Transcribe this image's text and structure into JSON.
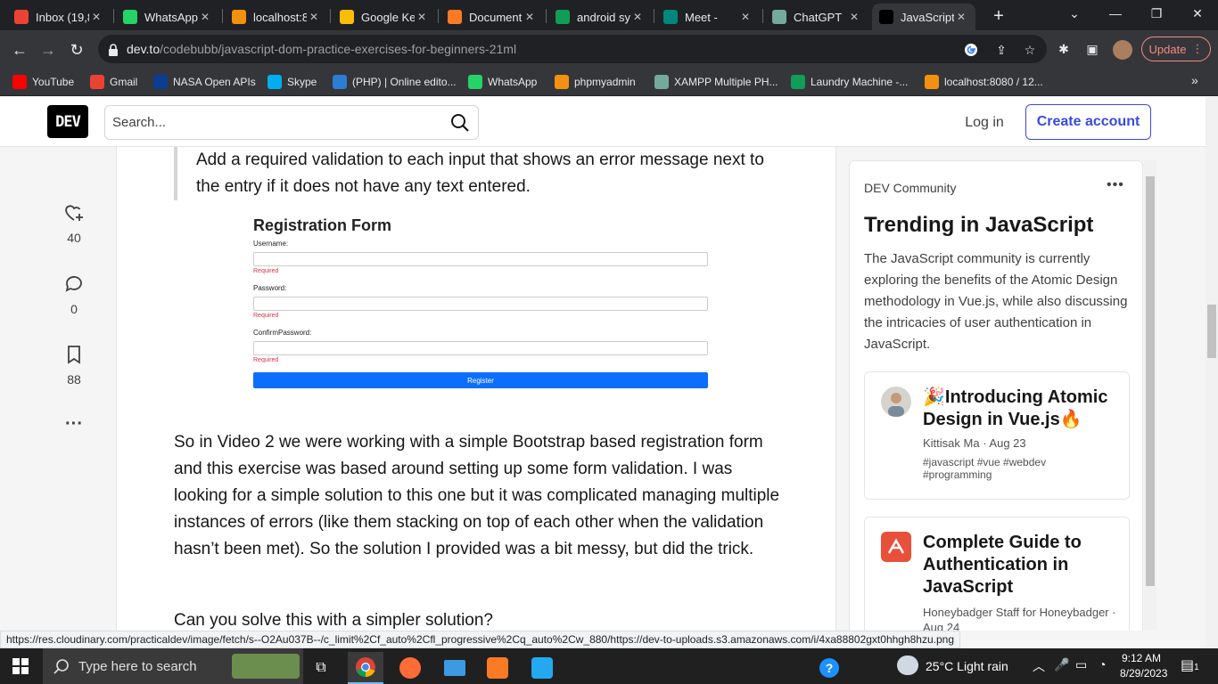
{
  "browser": {
    "tabs": [
      {
        "title": "Inbox (19,8",
        "icon": "gmail-icon",
        "color": "#ea4335"
      },
      {
        "title": "WhatsApp",
        "icon": "whatsapp-icon",
        "color": "#25d366"
      },
      {
        "title": "localhost:8",
        "icon": "phpmyadmin-icon",
        "color": "#f29111"
      },
      {
        "title": "Google Ke",
        "icon": "google-keep-icon",
        "color": "#fbbc04"
      },
      {
        "title": "Document",
        "icon": "xampp-icon",
        "color": "#fb7a24"
      },
      {
        "title": "android sy",
        "icon": "android-icon",
        "color": "#0f9d58"
      },
      {
        "title": "Meet -",
        "icon": "google-meet-icon",
        "color": "#00897b"
      },
      {
        "title": "ChatGPT",
        "icon": "chatgpt-icon",
        "color": "#74aa9c"
      },
      {
        "title": "JavaScript",
        "icon": "dev-icon",
        "color": "#000000",
        "active": true
      }
    ],
    "url_host": "dev.to",
    "url_path": "/codebubb/javascript-dom-practice-exercises-for-beginners-21ml",
    "update_label": "Update",
    "bookmarks": [
      {
        "label": "YouTube",
        "icon": "youtube-icon",
        "color": "#ff0000"
      },
      {
        "label": "Gmail",
        "icon": "gmail-icon",
        "color": "#ea4335"
      },
      {
        "label": "NASA Open APIs",
        "icon": "nasa-icon",
        "color": "#0b3d91"
      },
      {
        "label": "Skype",
        "icon": "skype-icon",
        "color": "#00aff0"
      },
      {
        "label": "(PHP) | Online edito...",
        "icon": "php-icon",
        "color": "#2d7dd2"
      },
      {
        "label": "WhatsApp",
        "icon": "whatsapp-icon",
        "color": "#25d366"
      },
      {
        "label": "phpmyadmin",
        "icon": "phpmyadmin-icon",
        "color": "#f29111"
      },
      {
        "label": "XAMPP Multiple PH...",
        "icon": "globe-icon",
        "color": "#74aa9c"
      },
      {
        "label": "Laundry Machine -...",
        "icon": "plus-icon",
        "color": "#0f9d58"
      },
      {
        "label": "localhost:8080 / 12...",
        "icon": "phpmyadmin-icon",
        "color": "#f29111"
      }
    ],
    "status_url": "https://res.cloudinary.com/practicaldev/image/fetch/s--O2Au037B--/c_limit%2Cf_auto%2Cfl_progressive%2Cq_auto%2Cw_880/https://dev-to-uploads.s3.amazonaws.com/i/4xa88802gxt0hhgh8hzu.png"
  },
  "header": {
    "logo": "DEV",
    "search_placeholder": "Search...",
    "login": "Log in",
    "create_account": "Create account"
  },
  "reactions": {
    "likes": "40",
    "comments": "0",
    "bookmarks": "88"
  },
  "article": {
    "blockquote": "Add a required validation to each input that shows an error message next to the entry if it does not have any text entered.",
    "figure": {
      "title": "Registration Form",
      "username_label": "Username:",
      "password_label": "Password:",
      "confirm_label": "ConfirmPassword:",
      "error": "Required",
      "button": "Register"
    },
    "paragraph1": "So in Video 2 we were working with a simple Bootstrap based registration form and this exercise was based around setting up some form validation. I was looking for a simple solution to this one but it was complicated managing multiple instances of errors (like them stacking on top of each other when the validation hasn’t been met). So the solution I provided was a bit messy, but did the trick.",
    "paragraph2": "Can you solve this with a simpler solution?"
  },
  "sidebar": {
    "source": "DEV Community",
    "title": "Trending in JavaScript",
    "description": "The JavaScript community is currently exploring the benefits of the Atomic Design methodology in Vue.js, while also discussing the intricacies of user authentication in JavaScript.",
    "cards": [
      {
        "title": "🎉Introducing Atomic Design in Vue.js🔥",
        "author": "Kittisak Ma",
        "date": "Aug 23",
        "tags": "#javascript  #vue  #webdev  #programming"
      },
      {
        "title": "Complete Guide to Authentication in JavaScript",
        "author": "Honeybadger Staff for Honeybadger",
        "date": "Aug 24"
      }
    ]
  },
  "taskbar": {
    "search_placeholder": "Type here to search",
    "weather": "25°C  Light rain",
    "time": "9:12 AM",
    "date": "8/29/2023",
    "notification_count": "1"
  }
}
